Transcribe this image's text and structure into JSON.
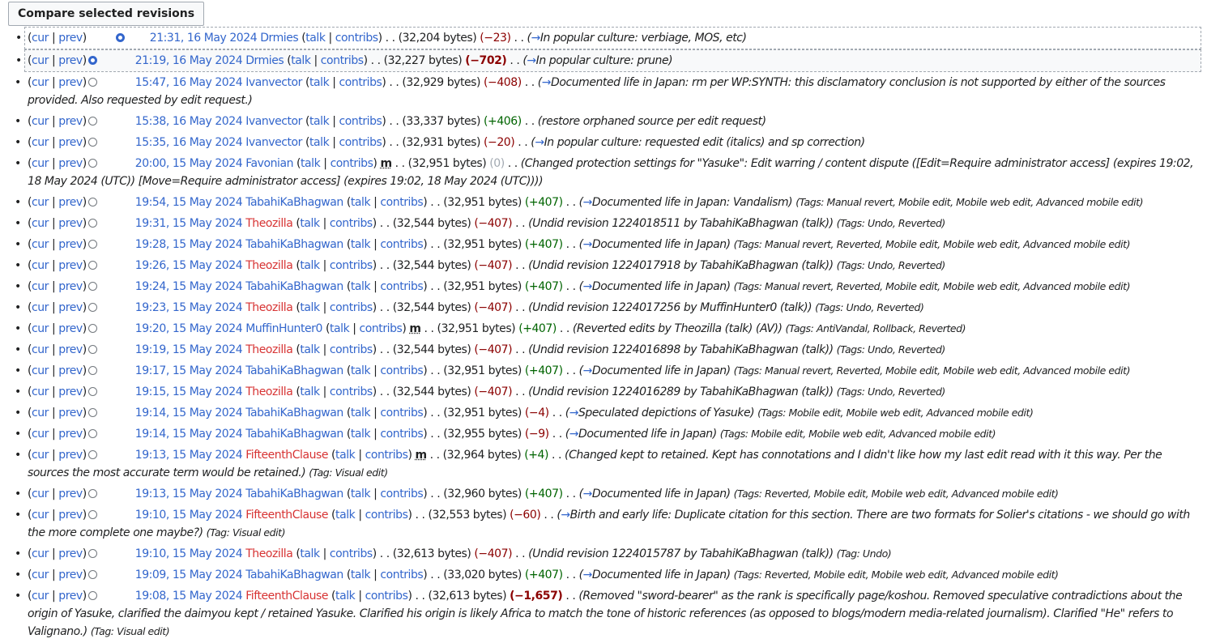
{
  "compare_label": "Compare selected revisions",
  "labels": {
    "cur": "cur",
    "prev": "prev",
    "talk": "talk",
    "contribs": "contribs",
    "minor": "m",
    "bytes_suffix": " bytes"
  },
  "rows": [
    {
      "date": "21:31, 16 May 2024",
      "user": "Drmies",
      "red": false,
      "size": "32,204",
      "diff": "−23",
      "dclass": "neg",
      "big": false,
      "minor": false,
      "sect": "In popular culture:",
      "text": " verbiage, MOS, etc",
      "tags": "",
      "state": "sel-first"
    },
    {
      "date": "21:19, 16 May 2024",
      "user": "Drmies",
      "red": false,
      "size": "32,227",
      "diff": "−702",
      "dclass": "neg",
      "big": true,
      "minor": false,
      "sect": "In popular culture:",
      "text": " prune",
      "tags": "",
      "state": "sel-second"
    },
    {
      "date": "15:47, 16 May 2024",
      "user": "Ivanvector",
      "red": false,
      "size": "32,929",
      "diff": "−408",
      "dclass": "neg",
      "big": false,
      "minor": false,
      "sect": "Documented life in Japan:",
      "text": " rm per WP:SYNTH: this disclamatory conclusion is not supported by either of the sources provided. Also requested by edit request.",
      "tags": ""
    },
    {
      "date": "15:38, 16 May 2024",
      "user": "Ivanvector",
      "red": false,
      "size": "33,337",
      "diff": "+406",
      "dclass": "pos",
      "big": false,
      "minor": false,
      "sect": "",
      "text": "restore orphaned source per edit request",
      "tags": ""
    },
    {
      "date": "15:35, 16 May 2024",
      "user": "Ivanvector",
      "red": false,
      "size": "32,931",
      "diff": "−20",
      "dclass": "neg",
      "big": false,
      "minor": false,
      "sect": "In popular culture:",
      "text": " requested edit (italics) and sp correction",
      "tags": ""
    },
    {
      "date": "20:00, 15 May 2024",
      "user": "Favonian",
      "red": false,
      "size": "32,951",
      "diff": "0",
      "dclass": "zero",
      "big": false,
      "minor": true,
      "sect": "",
      "text": "Changed protection settings for \"Yasuke\": Edit warring / content dispute ([Edit=Require administrator access] (expires 19:02, 18 May 2024 (UTC)) [Move=Require administrator access] (expires 19:02, 18 May 2024 (UTC)))",
      "tags": ""
    },
    {
      "date": "19:54, 15 May 2024",
      "user": "TabahiKaBhagwan",
      "red": false,
      "size": "32,951",
      "diff": "+407",
      "dclass": "pos",
      "big": false,
      "minor": false,
      "sect": "Documented life in Japan:",
      "text": " Vandalism",
      "tags": "(Tags: Manual revert, Mobile edit, Mobile web edit, Advanced mobile edit)"
    },
    {
      "date": "19:31, 15 May 2024",
      "user": "Theozilla",
      "red": true,
      "size": "32,544",
      "diff": "−407",
      "dclass": "neg",
      "big": false,
      "minor": false,
      "sect": "",
      "text": "Undid revision 1224018511 by TabahiKaBhagwan (talk)",
      "tags": "(Tags: Undo, Reverted)"
    },
    {
      "date": "19:28, 15 May 2024",
      "user": "TabahiKaBhagwan",
      "red": false,
      "size": "32,951",
      "diff": "+407",
      "dclass": "pos",
      "big": false,
      "minor": false,
      "sect": "Documented life in Japan",
      "text": "",
      "tags": "(Tags: Manual revert, Reverted, Mobile edit, Mobile web edit, Advanced mobile edit)"
    },
    {
      "date": "19:26, 15 May 2024",
      "user": "Theozilla",
      "red": true,
      "size": "32,544",
      "diff": "−407",
      "dclass": "neg",
      "big": false,
      "minor": false,
      "sect": "",
      "text": "Undid revision 1224017918 by TabahiKaBhagwan (talk)",
      "tags": "(Tags: Undo, Reverted)"
    },
    {
      "date": "19:24, 15 May 2024",
      "user": "TabahiKaBhagwan",
      "red": false,
      "size": "32,951",
      "diff": "+407",
      "dclass": "pos",
      "big": false,
      "minor": false,
      "sect": "Documented life in Japan",
      "text": "",
      "tags": "(Tags: Manual revert, Reverted, Mobile edit, Mobile web edit, Advanced mobile edit)"
    },
    {
      "date": "19:23, 15 May 2024",
      "user": "Theozilla",
      "red": true,
      "size": "32,544",
      "diff": "−407",
      "dclass": "neg",
      "big": false,
      "minor": false,
      "sect": "",
      "text": "Undid revision 1224017256 by MuffinHunter0 (talk)",
      "tags": "(Tags: Undo, Reverted)"
    },
    {
      "date": "19:20, 15 May 2024",
      "user": "MuffinHunter0",
      "red": false,
      "size": "32,951",
      "diff": "+407",
      "dclass": "pos",
      "big": false,
      "minor": true,
      "sect": "",
      "text": "Reverted edits by Theozilla (talk) (AV)",
      "tags": "(Tags: AntiVandal, Rollback, Reverted)"
    },
    {
      "date": "19:19, 15 May 2024",
      "user": "Theozilla",
      "red": true,
      "size": "32,544",
      "diff": "−407",
      "dclass": "neg",
      "big": false,
      "minor": false,
      "sect": "",
      "text": "Undid revision 1224016898 by TabahiKaBhagwan (talk)",
      "tags": "(Tags: Undo, Reverted)"
    },
    {
      "date": "19:17, 15 May 2024",
      "user": "TabahiKaBhagwan",
      "red": false,
      "size": "32,951",
      "diff": "+407",
      "dclass": "pos",
      "big": false,
      "minor": false,
      "sect": "Documented life in Japan",
      "text": "",
      "tags": "(Tags: Manual revert, Reverted, Mobile edit, Mobile web edit, Advanced mobile edit)"
    },
    {
      "date": "19:15, 15 May 2024",
      "user": "Theozilla",
      "red": true,
      "size": "32,544",
      "diff": "−407",
      "dclass": "neg",
      "big": false,
      "minor": false,
      "sect": "",
      "text": "Undid revision 1224016289 by TabahiKaBhagwan (talk)",
      "tags": "(Tags: Undo, Reverted)"
    },
    {
      "date": "19:14, 15 May 2024",
      "user": "TabahiKaBhagwan",
      "red": false,
      "size": "32,951",
      "diff": "−4",
      "dclass": "neg",
      "big": false,
      "minor": false,
      "sect": "Speculated depictions of Yasuke",
      "text": "",
      "tags": "(Tags: Mobile edit, Mobile web edit, Advanced mobile edit)"
    },
    {
      "date": "19:14, 15 May 2024",
      "user": "TabahiKaBhagwan",
      "red": false,
      "size": "32,955",
      "diff": "−9",
      "dclass": "neg",
      "big": false,
      "minor": false,
      "sect": "Documented life in Japan",
      "text": "",
      "tags": "(Tags: Mobile edit, Mobile web edit, Advanced mobile edit)"
    },
    {
      "date": "19:13, 15 May 2024",
      "user": "FifteenthClause",
      "red": true,
      "size": "32,964",
      "diff": "+4",
      "dclass": "pos",
      "big": false,
      "minor": true,
      "sect": "",
      "text": "Changed kept to retained. Kept has connotations and I didn't like how my last edit read with it this way. Per the sources the most accurate term would be retained.",
      "tags": "(Tag: Visual edit)"
    },
    {
      "date": "19:13, 15 May 2024",
      "user": "TabahiKaBhagwan",
      "red": false,
      "size": "32,960",
      "diff": "+407",
      "dclass": "pos",
      "big": false,
      "minor": false,
      "sect": "Documented life in Japan",
      "text": "",
      "tags": "(Tags: Reverted, Mobile edit, Mobile web edit, Advanced mobile edit)"
    },
    {
      "date": "19:10, 15 May 2024",
      "user": "FifteenthClause",
      "red": true,
      "size": "32,553",
      "diff": "−60",
      "dclass": "neg",
      "big": false,
      "minor": false,
      "sect": "Birth and early life:",
      "text": " Duplicate citation for this section. There are two formats for Solier's citations - we should go with the more complete one maybe?",
      "tags": "(Tag: Visual edit)"
    },
    {
      "date": "19:10, 15 May 2024",
      "user": "Theozilla",
      "red": true,
      "size": "32,613",
      "diff": "−407",
      "dclass": "neg",
      "big": false,
      "minor": false,
      "sect": "",
      "text": "Undid revision 1224015787 by TabahiKaBhagwan (talk)",
      "tags": "(Tag: Undo)"
    },
    {
      "date": "19:09, 15 May 2024",
      "user": "TabahiKaBhagwan",
      "red": false,
      "size": "33,020",
      "diff": "+407",
      "dclass": "pos",
      "big": false,
      "minor": false,
      "sect": "Documented life in Japan",
      "text": "",
      "tags": "(Tags: Reverted, Mobile edit, Mobile web edit, Advanced mobile edit)"
    },
    {
      "date": "19:08, 15 May 2024",
      "user": "FifteenthClause",
      "red": true,
      "size": "32,613",
      "diff": "−1,657",
      "dclass": "neg",
      "big": true,
      "minor": false,
      "sect": "",
      "text": "Removed \"sword-bearer\" as the rank is specifically page/koshou. Removed speculative contradictions about the origin of Yasuke, clarified the daimyou kept / retained Yasuke. Clarified his origin is likely Africa to match the tone of historic references (as opposed to blogs/modern media-related journalism). Clarified \"He\" refers to Valignano.",
      "tags": "(Tag: Visual edit)"
    }
  ]
}
